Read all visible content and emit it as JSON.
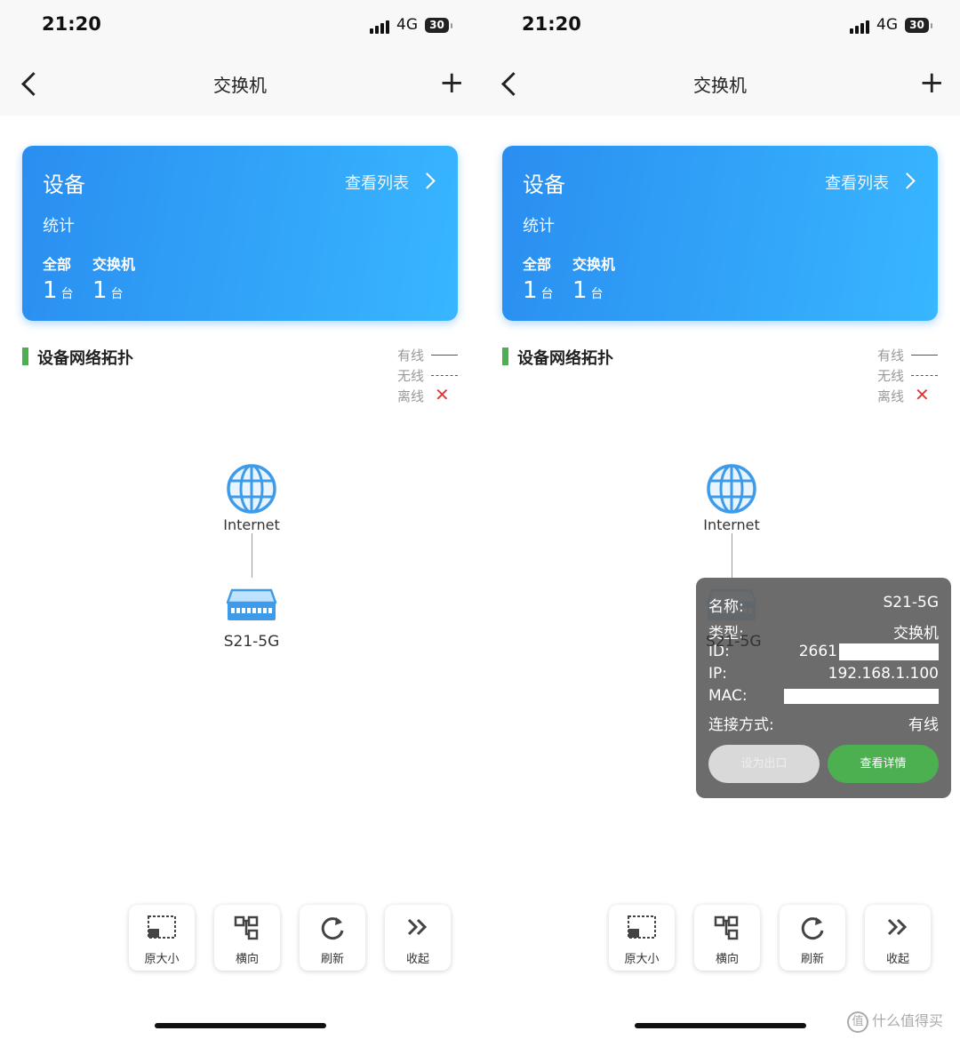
{
  "status": {
    "time": "21:20",
    "network": "4G",
    "battery": "30"
  },
  "nav": {
    "title": "交换机"
  },
  "card": {
    "title": "设备",
    "view_list": "查看列表",
    "stats_title": "统计",
    "stats": [
      {
        "label": "全部",
        "value": "1",
        "unit": "台"
      },
      {
        "label": "交换机",
        "value": "1",
        "unit": "台"
      }
    ]
  },
  "topology": {
    "title": "设备网络拓扑",
    "legend": {
      "wired": "有线",
      "wireless": "无线",
      "offline": "离线"
    },
    "internet_label": "Internet",
    "switch_label": "S21-5G"
  },
  "toolbar": {
    "original_size": "原大小",
    "horizontal": "横向",
    "refresh": "刷新",
    "collapse": "收起"
  },
  "popup": {
    "name_key": "名称:",
    "name_value": "S21-5G",
    "type_key": "类型:",
    "type_value": "交换机",
    "id_key": "ID:",
    "id_value": "2661",
    "ip_key": "IP:",
    "ip_value": "192.168.1.100",
    "mac_key": "MAC:",
    "conn_key": "连接方式:",
    "conn_value": "有线",
    "set_exit": "设为出口",
    "view_detail": "查看详情"
  },
  "watermark": {
    "logo": "值",
    "text": "什么值得买"
  },
  "colors": {
    "card_start": "#2a8ef0",
    "card_end": "#38b6ff",
    "accent_green": "#4caf50",
    "offline_red": "#e53935"
  },
  "icons": [
    "back-arrow-icon",
    "plus-icon",
    "chevron-right-icon",
    "globe-icon",
    "switch-icon",
    "original-size-icon",
    "horizontal-layout-icon",
    "refresh-icon",
    "collapse-icon"
  ]
}
